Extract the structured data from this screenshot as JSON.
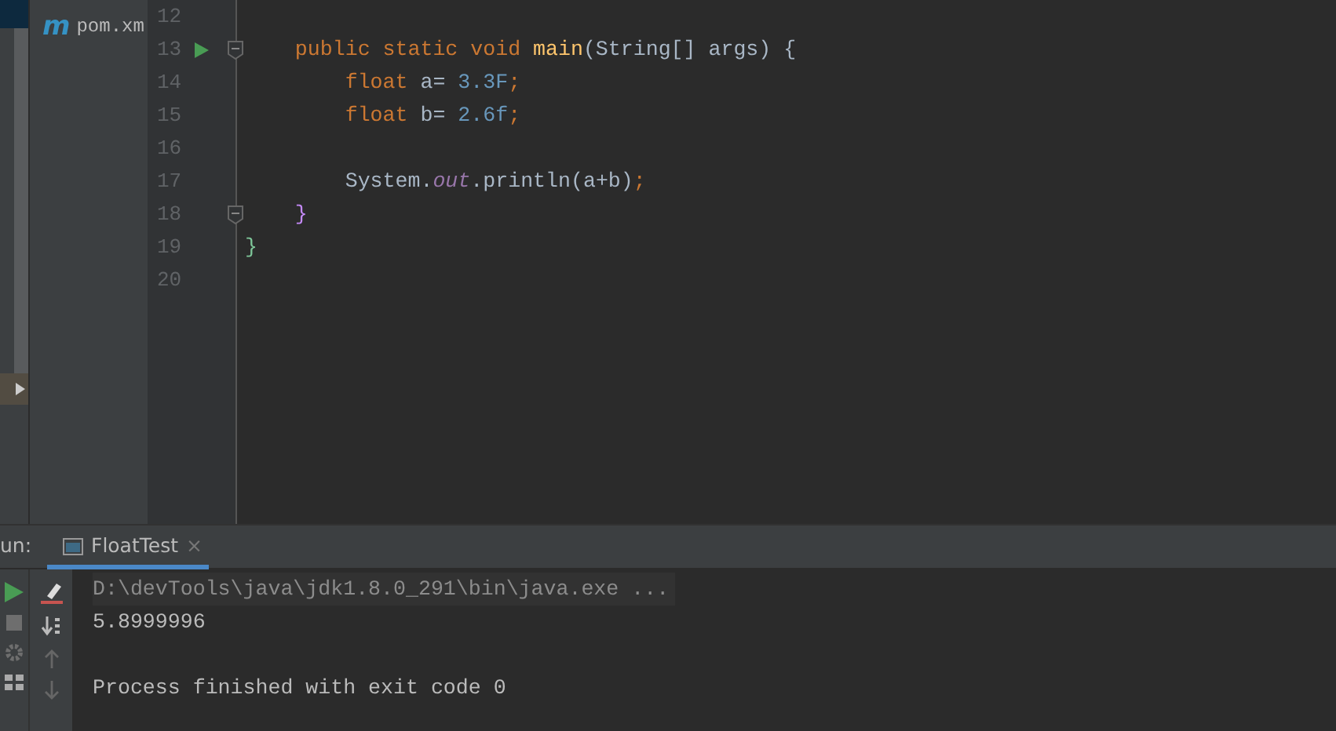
{
  "project_tree": {
    "items": [
      {
        "label": "pom.xm",
        "icon": "m"
      }
    ]
  },
  "editor": {
    "lines": [
      {
        "number": "12"
      },
      {
        "number": "13",
        "run": true,
        "fold": true,
        "tokens": [
          {
            "text": "    public static void ",
            "kind": "keyword"
          },
          {
            "text": "main",
            "kind": "method"
          },
          {
            "text": "(String[] args) {",
            "kind": "plain"
          }
        ]
      },
      {
        "number": "14",
        "tokens": [
          {
            "text": "        float ",
            "kind": "keyword"
          },
          {
            "text": "a= ",
            "kind": "plain"
          },
          {
            "text": "3.3F",
            "kind": "number"
          },
          {
            "text": ";",
            "kind": "keyword"
          }
        ]
      },
      {
        "number": "15",
        "tokens": [
          {
            "text": "        float ",
            "kind": "keyword"
          },
          {
            "text": "b= ",
            "kind": "plain"
          },
          {
            "text": "2.6f",
            "kind": "number"
          },
          {
            "text": ";",
            "kind": "keyword"
          }
        ]
      },
      {
        "number": "16"
      },
      {
        "number": "17",
        "tokens": [
          {
            "text": "        System.",
            "kind": "plain"
          },
          {
            "text": "out",
            "kind": "field"
          },
          {
            "text": ".println(a+b)",
            "kind": "plain"
          },
          {
            "text": ";",
            "kind": "keyword"
          }
        ]
      },
      {
        "number": "18",
        "fold": true,
        "tokens": [
          {
            "text": "    }",
            "kind": "brace2"
          }
        ]
      },
      {
        "number": "19",
        "tokens": [
          {
            "text": "}",
            "kind": "brace1"
          }
        ]
      },
      {
        "number": "20"
      }
    ]
  },
  "run_panel": {
    "label": "un:",
    "tabs": [
      {
        "label": "FloatTest",
        "close": "×",
        "selected": true
      }
    ],
    "console": [
      {
        "text": "D:\\devTools\\java\\jdk1.8.0_291\\bin\\java.exe ...",
        "kind": "command"
      },
      {
        "text": "5.8999996",
        "kind": "output"
      },
      {
        "kind": "blank"
      },
      {
        "text": "Process finished with exit code 0",
        "kind": "output"
      }
    ]
  }
}
